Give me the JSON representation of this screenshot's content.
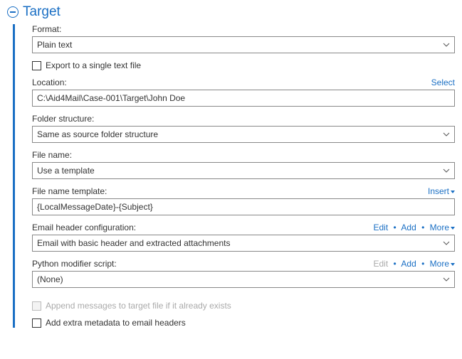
{
  "section_title": "Target",
  "format": {
    "label": "Format:",
    "value": "Plain text"
  },
  "export_single": {
    "label": "Export to a single text file",
    "checked": false,
    "enabled": true
  },
  "location": {
    "label": "Location:",
    "action": "Select",
    "value": "C:\\Aid4Mail\\Case-001\\Target\\John Doe"
  },
  "folder_structure": {
    "label": "Folder structure:",
    "value": "Same as source folder structure"
  },
  "file_name": {
    "label": "File name:",
    "value": "Use a template"
  },
  "file_name_template": {
    "label": "File name template:",
    "action": "Insert",
    "value": "{LocalMessageDate}-{Subject}"
  },
  "email_header_config": {
    "label": "Email header configuration:",
    "actions": {
      "edit": "Edit",
      "add": "Add",
      "more": "More",
      "edit_enabled": true
    },
    "value": "Email with basic header and extracted attachments"
  },
  "python_script": {
    "label": "Python modifier script:",
    "actions": {
      "edit": "Edit",
      "add": "Add",
      "more": "More",
      "edit_enabled": false
    },
    "value": "(None)"
  },
  "append_messages": {
    "label": "Append messages to target file if it already exists",
    "checked": false,
    "enabled": false
  },
  "add_metadata": {
    "label": "Add extra metadata to email headers",
    "checked": false,
    "enabled": true
  }
}
